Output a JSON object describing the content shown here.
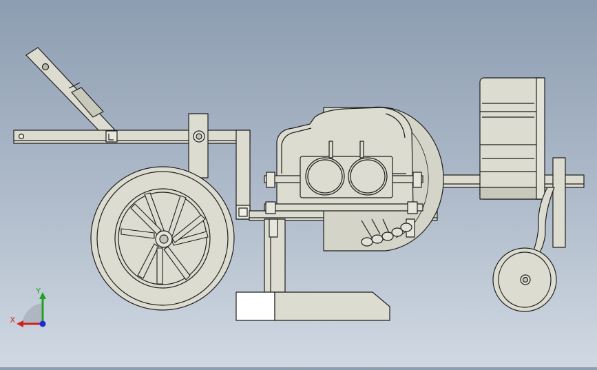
{
  "viewport": {
    "background_top": "#8d9db1",
    "background_bottom": "#d0d9e3"
  },
  "model": {
    "part_fill": "#dcdcd0",
    "part_fill_dark": "#b8b8aa",
    "edge_color": "#1e1e1e",
    "white_face": "#ffffff"
  },
  "triad": {
    "x_label": "X",
    "y_label": "Y",
    "x_color": "#d32020",
    "y_color": "#1fa31f",
    "z_color": "#1c2bd6"
  },
  "icons": {
    "coordinate_triad": "triad-icon"
  }
}
